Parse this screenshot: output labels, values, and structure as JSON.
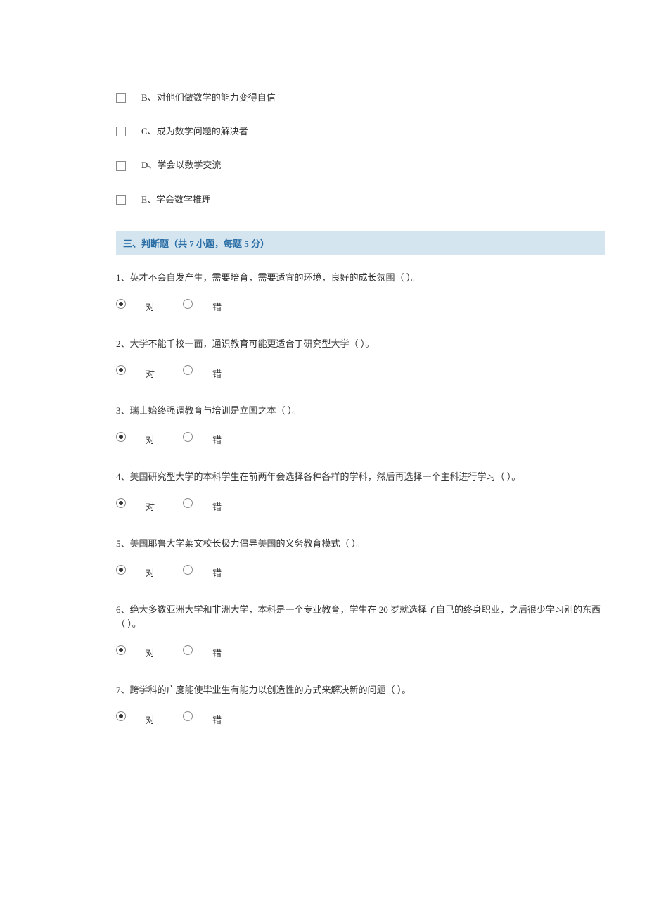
{
  "multichoice": {
    "options": [
      {
        "letter": "B",
        "text": "对他们做数学的能力变得自信"
      },
      {
        "letter": "C",
        "text": "成为数学问题的解决者"
      },
      {
        "letter": "D",
        "text": "学会以数学交流"
      },
      {
        "letter": "E",
        "text": "学会数学推理"
      }
    ]
  },
  "section3": {
    "header": "三、判断题（共 7 小题，每题 5 分）",
    "true_label": "对",
    "false_label": "错",
    "questions": [
      {
        "num": "1",
        "text": "英才不会自发产生，需要培育，需要适宜的环境，良好的成长氛围（ ）。",
        "selected": "true"
      },
      {
        "num": "2",
        "text": "大学不能千校一面，通识教育可能更适合于研究型大学（ ）。",
        "selected": "true"
      },
      {
        "num": "3",
        "text": "瑞士始终强调教育与培训是立国之本（ ）。",
        "selected": "true"
      },
      {
        "num": "4",
        "text": "美国研究型大学的本科学生在前两年会选择各种各样的学科，然后再选择一个主科进行学习（ ）。",
        "selected": "true"
      },
      {
        "num": "5",
        "text": "美国耶鲁大学莱文校长极力倡导美国的义务教育模式（ ）。",
        "selected": "true"
      },
      {
        "num": "6",
        "text": "绝大多数亚洲大学和非洲大学，本科是一个专业教育，学生在 20 岁就选择了自己的终身职业，之后很少学习别的东西（ ）。",
        "selected": "true"
      },
      {
        "num": "7",
        "text": "跨学科的广度能使毕业生有能力以创造性的方式来解决新的问题（ ）。",
        "selected": "true"
      }
    ]
  }
}
